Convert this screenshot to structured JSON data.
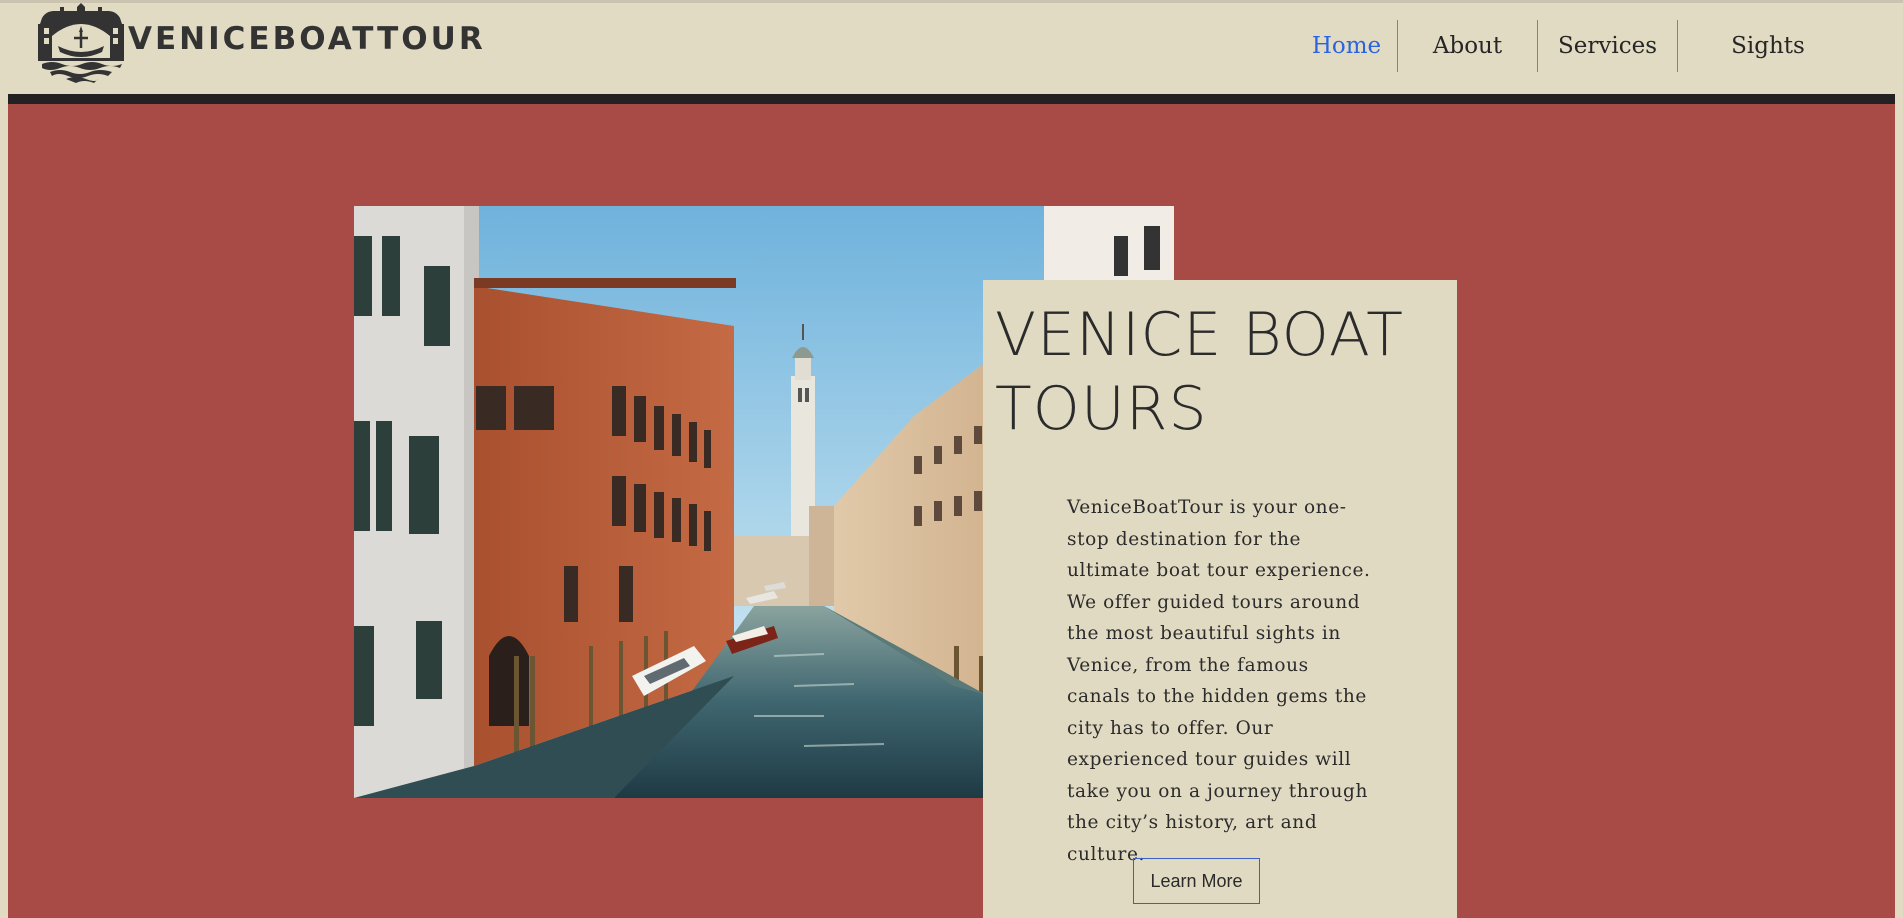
{
  "brand": {
    "name": "VENICEBOATTOUR",
    "logo_icon": "gondola-bridge-logo"
  },
  "nav": {
    "items": [
      {
        "label": "Home",
        "active": true
      },
      {
        "label": "About",
        "active": false
      },
      {
        "label": "Services",
        "active": false
      },
      {
        "label": "Sights",
        "active": false
      }
    ],
    "active_color": "#2a64e0"
  },
  "hero": {
    "background_color": "#a84b46",
    "image": "venice-canal-photo",
    "card": {
      "title": "VENICE BOAT TOURS",
      "body": "VeniceBoatTour is your one-stop destination for the ultimate boat tour experience. We offer guided tours around the most beautiful sights in Venice, from the famous canals to the hidden gems the city has to offer. Our experienced tour guides will take you on a journey through the city’s history, art and culture.",
      "button_label": "Learn More"
    }
  },
  "colors": {
    "header_bg": "#e2dbc3",
    "header_bar": "#222222",
    "card_bg": "#e1dac3",
    "button_border": "#3b61c4"
  }
}
